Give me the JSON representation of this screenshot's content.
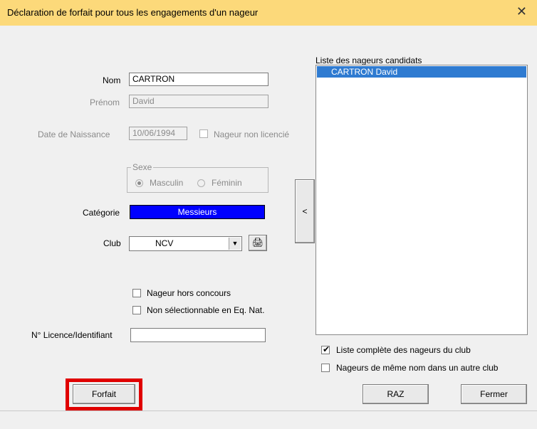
{
  "window": {
    "title": "Déclaration de forfait pour tous les engagements d'un nageur",
    "close_glyph": "✕"
  },
  "form": {
    "nom_label": "Nom",
    "nom_value": "CARTRON",
    "prenom_label": "Prénom",
    "prenom_value": "David",
    "ddn_label": "Date de Naissance",
    "ddn_value": "10/06/1994",
    "non_licencie_label": "Nageur non licencié",
    "sexe_legend": "Sexe",
    "masculin_label": "Masculin",
    "feminin_label": "Féminin",
    "categorie_label": "Catégorie",
    "categorie_value": "Messieurs",
    "club_label": "Club",
    "club_value": "NCV",
    "hors_concours_label": "Nageur hors concours",
    "non_selectionnable_label": "Non sélectionnable en Eq. Nat.",
    "licence_label": "N° Licence/Identifiant",
    "licence_value": ""
  },
  "list": {
    "header": "Liste des nageurs candidats",
    "items": [
      "CARTRON David"
    ],
    "arrow_label": "<",
    "option_complete_label": "Liste complète des nageurs du club",
    "option_complete_checked": true,
    "option_autre_club_label": "Nageurs de même nom dans un autre club",
    "option_autre_club_checked": false
  },
  "buttons": {
    "forfait": "Forfait",
    "raz": "RAZ",
    "fermer": "Fermer"
  },
  "colors": {
    "titlebar": "#fcd97a",
    "categorie_bg": "#0000ff",
    "selection": "#2f7bd1",
    "highlight": "#e00000"
  }
}
